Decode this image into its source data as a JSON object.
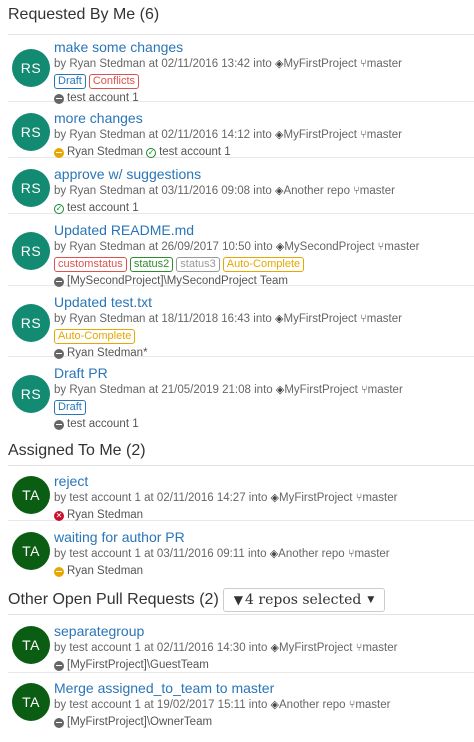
{
  "sections": [
    {
      "title": "Requested By Me",
      "count": "(6)",
      "items": [
        {
          "initials": "RS",
          "avatar_color": "#138a72",
          "title": "make some changes",
          "meta_prefix": "by Ryan Stedman at 02/11/2016 13:42 into",
          "repo": "MyFirstProject",
          "branch": "master",
          "labels": [
            {
              "text": "Draft",
              "color": "#2a75b7"
            },
            {
              "text": "Conflicts",
              "color": "#d9534f"
            }
          ],
          "reviewers": [
            {
              "name": "test account 1",
              "vote": "none"
            }
          ]
        },
        {
          "initials": "RS",
          "avatar_color": "#138a72",
          "title": "more changes",
          "meta_prefix": "by Ryan Stedman at 02/11/2016 14:12 into",
          "repo": "MyFirstProject",
          "branch": "master",
          "labels": [],
          "reviewers": [
            {
              "name": "Ryan Stedman",
              "vote": "wait"
            },
            {
              "name": "test account 1",
              "vote": "approve"
            }
          ]
        },
        {
          "initials": "RS",
          "avatar_color": "#138a72",
          "title": "approve w/ suggestions",
          "meta_prefix": "by Ryan Stedman at 03/11/2016 09:08 into",
          "repo": "Another repo",
          "branch": "master",
          "labels": [],
          "reviewers": [
            {
              "name": "test account 1",
              "vote": "approve"
            }
          ]
        },
        {
          "initials": "RS",
          "avatar_color": "#138a72",
          "title": "Updated README.md",
          "meta_prefix": "by Ryan Stedman at 26/09/2017 10:50 into",
          "repo": "MySecondProject",
          "branch": "master",
          "labels": [
            {
              "text": "customstatus",
              "color": "#d9534f"
            },
            {
              "text": "status2",
              "color": "#2e8b2e"
            },
            {
              "text": "status3",
              "color": "#999999"
            },
            {
              "text": "Auto-Complete",
              "color": "#e6a700"
            }
          ],
          "reviewers": [
            {
              "name": "[MySecondProject]\\MySecondProject Team",
              "vote": "none"
            }
          ]
        },
        {
          "initials": "RS",
          "avatar_color": "#138a72",
          "title": "Updated test.txt",
          "meta_prefix": "by Ryan Stedman at 18/11/2018 16:43 into",
          "repo": "MyFirstProject",
          "branch": "master",
          "labels": [
            {
              "text": "Auto-Complete",
              "color": "#e6a700"
            }
          ],
          "reviewers": [
            {
              "name": "Ryan Stedman*",
              "vote": "none"
            }
          ]
        },
        {
          "initials": "RS",
          "avatar_color": "#138a72",
          "title": "Draft PR",
          "meta_prefix": "by Ryan Stedman at 21/05/2019 21:08 into",
          "repo": "MyFirstProject",
          "branch": "master",
          "labels": [
            {
              "text": "Draft",
              "color": "#2a75b7"
            }
          ],
          "reviewers": [
            {
              "name": "test account 1",
              "vote": "none"
            }
          ]
        }
      ]
    },
    {
      "title": "Assigned To Me",
      "count": "(2)",
      "items": [
        {
          "initials": "TA",
          "avatar_color": "#0b5d14",
          "title": "reject",
          "meta_prefix": "by test account 1 at 02/11/2016 14:27 into",
          "repo": "MyFirstProject",
          "branch": "master",
          "labels": [],
          "reviewers": [
            {
              "name": "Ryan Stedman",
              "vote": "reject"
            }
          ]
        },
        {
          "initials": "TA",
          "avatar_color": "#0b5d14",
          "title": "waiting for author PR",
          "meta_prefix": "by test account 1 at 03/11/2016 09:11 into",
          "repo": "Another repo",
          "branch": "master",
          "labels": [],
          "reviewers": [
            {
              "name": "Ryan Stedman",
              "vote": "wait"
            }
          ]
        }
      ]
    },
    {
      "title": "Other Open Pull Requests",
      "count": "(2)",
      "filter_label": "4 repos selected",
      "items": [
        {
          "initials": "TA",
          "avatar_color": "#0b5d14",
          "title": "separategroup",
          "meta_prefix": "by test account 1 at 02/11/2016 14:30 into",
          "repo": "MyFirstProject",
          "branch": "master",
          "labels": [],
          "reviewers": [
            {
              "name": "[MyFirstProject]\\GuestTeam",
              "vote": "none"
            }
          ]
        },
        {
          "initials": "TA",
          "avatar_color": "#0b5d14",
          "title": "Merge assigned_to_team to master",
          "meta_prefix": "by test account 1 at 19/02/2017 15:11 into",
          "repo": "Another repo",
          "branch": "master",
          "labels": [],
          "reviewers": [
            {
              "name": "[MyFirstProject]\\OwnerTeam",
              "vote": "none"
            }
          ]
        }
      ]
    }
  ]
}
